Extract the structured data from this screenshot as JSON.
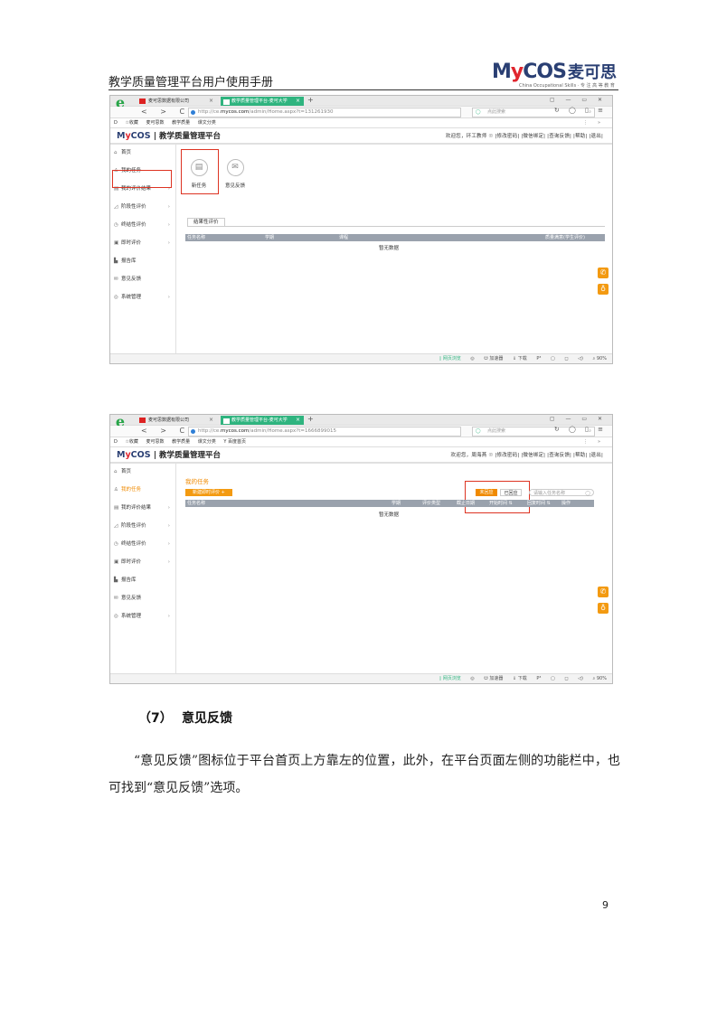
{
  "header": {
    "title": "教学质量管理平台用户使用手册",
    "logo_text_a": "M",
    "logo_text_y": "y",
    "logo_text_b": "COS",
    "logo_cn": "麦可思",
    "logo_sub": "China Occupational Skills · 专 注 高 等 教 育"
  },
  "shot1": {
    "tabs": [
      {
        "label": "麦可思数据有限公司",
        "close": "×"
      },
      {
        "label": "教学质量管理平台-麦可大学",
        "close": "×"
      }
    ],
    "new_tab": "+",
    "window_controls": "▢ — ▭ ✕",
    "nav_buttons": "< > C ⌂",
    "url_prefix": "http://ce.",
    "url_domain": "mycos.com",
    "url_rest": "/admin/Home.aspx?t=131261930",
    "search_placeholder": "点此搜索",
    "nav_right": "↻ ◯ ▯ ≡",
    "bookmarks": [
      "D",
      "☆收藏",
      "麦可思数",
      "教学质量",
      "课文分类"
    ],
    "bookmark_more": "⋮",
    "bookmark_dd": "»",
    "brand_a": "M",
    "brand_y": "y",
    "brand_b": "COS",
    "brand_cn": "| 教学质量管理平台",
    "user_info": "欢迎您，环工教师 ☉   |修改密码| |微信绑定| |查询反馈| |帮助| |退出|",
    "sidebar": [
      {
        "label": "首页",
        "icon": "⌂",
        "arrow": ""
      },
      {
        "label": "我的任务",
        "icon": "♙",
        "arrow": ""
      },
      {
        "label": "我的评价结果",
        "icon": "▤",
        "arrow": "›"
      },
      {
        "label": "阶段性评价",
        "icon": "◿",
        "arrow": "›"
      },
      {
        "label": "终结性评价",
        "icon": "◷",
        "arrow": "›"
      },
      {
        "label": "即时评价",
        "icon": "▣",
        "arrow": "›"
      },
      {
        "label": "报告库",
        "icon": "▙",
        "arrow": ""
      },
      {
        "label": "意见反馈",
        "icon": "✉",
        "arrow": ""
      },
      {
        "label": "系统管理",
        "icon": "◎",
        "arrow": "›"
      }
    ],
    "tile1_label": "新任务",
    "tile1_icon": "▤",
    "tile2_label": "意见反馈",
    "tile2_icon": "✉",
    "subtab": "结果性评价",
    "columns": [
      "任务名称",
      "学期",
      "课程",
      "质量满意(学生评价)"
    ],
    "nodata": "暂无数据",
    "status": {
      "mode": "▯ 网页浏览",
      "items": [
        "◎",
        "☋ 加速器",
        "⇓ 下载",
        "P³",
        "▢",
        "◻",
        "◁)",
        "⌕ 90%"
      ]
    }
  },
  "shot2": {
    "tabs": [
      {
        "label": "麦可思数据有限公司",
        "close": "×"
      },
      {
        "label": "教学质量管理平台-麦可大学",
        "close": "×"
      }
    ],
    "new_tab": "+",
    "window_controls": "▢ — ▭ ✕",
    "nav_buttons": "< > C ⌂",
    "url_prefix": "http://ce.",
    "url_domain": "mycos.com",
    "url_rest": "/admin/Home.aspx?t=1666899015",
    "search_placeholder": "点此搜索",
    "nav_right": "↻ ◯ ▯ ≡",
    "bookmarks": [
      "D",
      "☆收藏",
      "麦可思数",
      "教学质量",
      "课文分类",
      "Y 百度首页"
    ],
    "bookmark_more": "⋮",
    "bookmark_dd": "»",
    "brand_a": "M",
    "brand_y": "y",
    "brand_b": "COS",
    "brand_cn": "| 教学质量管理平台",
    "user_info": "欢迎您，周海燕 ☉   |修改密码| |微信绑定| |查询反馈| |帮助| |退出|",
    "sidebar": [
      {
        "label": "首页",
        "icon": "⌂",
        "arrow": ""
      },
      {
        "label": "我的任务",
        "icon": "♙",
        "arrow": ""
      },
      {
        "label": "我的评价结果",
        "icon": "▤",
        "arrow": "›"
      },
      {
        "label": "阶段性评价",
        "icon": "◿",
        "arrow": "›"
      },
      {
        "label": "终结性评价",
        "icon": "◷",
        "arrow": "›"
      },
      {
        "label": "即时评价",
        "icon": "▣",
        "arrow": "›"
      },
      {
        "label": "报告库",
        "icon": "▙",
        "arrow": ""
      },
      {
        "label": "意见反馈",
        "icon": "✉",
        "arrow": ""
      },
      {
        "label": "系统管理",
        "icon": "◎",
        "arrow": "›"
      }
    ],
    "page_title": "我的任务",
    "new_eval_button": "新建即时评价 +",
    "seg_unanswered": "未回应",
    "seg_answered": "已回应",
    "search_placeholder_task": "请输入任务名称",
    "columns": [
      "任务名称",
      "学期",
      "评价类型",
      "截止日期",
      "开始时间 ⇅",
      "回复时间 ⇅",
      "操作"
    ],
    "nodata": "暂无数据",
    "status": {
      "mode": "▯ 网页浏览",
      "items": [
        "◎",
        "☋ 加速器",
        "⇓ 下载",
        "P³",
        "▢",
        "◻",
        "◁)",
        "⌕ 90%"
      ]
    }
  },
  "section": {
    "number": "（7）",
    "title": "意见反馈"
  },
  "paragraph": "“意见反馈”图标位于平台首页上方靠左的位置，此外，在平台页面左侧的功能栏中，也可找到“意见反馈”选项。",
  "page_number": "9",
  "colors": {
    "accent": "#f08a00",
    "brand": "#2a3f73",
    "brand_red": "#e0262e",
    "tab_active": "#2fb47f",
    "highlight": "#d32"
  }
}
